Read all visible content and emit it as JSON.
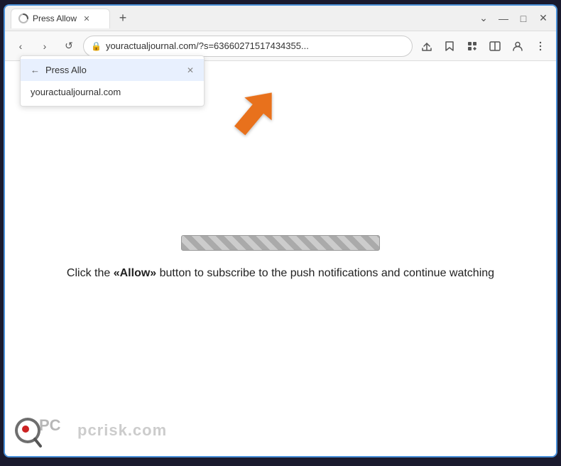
{
  "browser": {
    "tab": {
      "title": "Press Allow",
      "favicon_alt": "loading"
    },
    "new_tab_label": "+",
    "window_controls": {
      "minimize": "—",
      "maximize": "□",
      "close": "✕"
    },
    "address_bar": {
      "back_label": "‹",
      "forward_label": "›",
      "reload_label": "↺",
      "url": "youractualjournal.com/?s=63660271517434355...",
      "lock_icon": "🔒"
    },
    "toolbar": {
      "share_icon": "⬆",
      "star_icon": "☆",
      "extensions_icon": "🧩",
      "split_icon": "▱",
      "profile_icon": "👤",
      "menu_icon": "⋮"
    }
  },
  "autocomplete": {
    "items": [
      {
        "icon": "←",
        "label": "Press Allo",
        "close": "✕"
      },
      {
        "label": "youractualjournal.com"
      }
    ]
  },
  "page": {
    "instruction_text_before": "Click the ",
    "instruction_allow": "«Allow»",
    "instruction_text_after": " button to subscribe to the push notifications and continue watching"
  },
  "watermark": {
    "site": "pcrisk.com"
  }
}
